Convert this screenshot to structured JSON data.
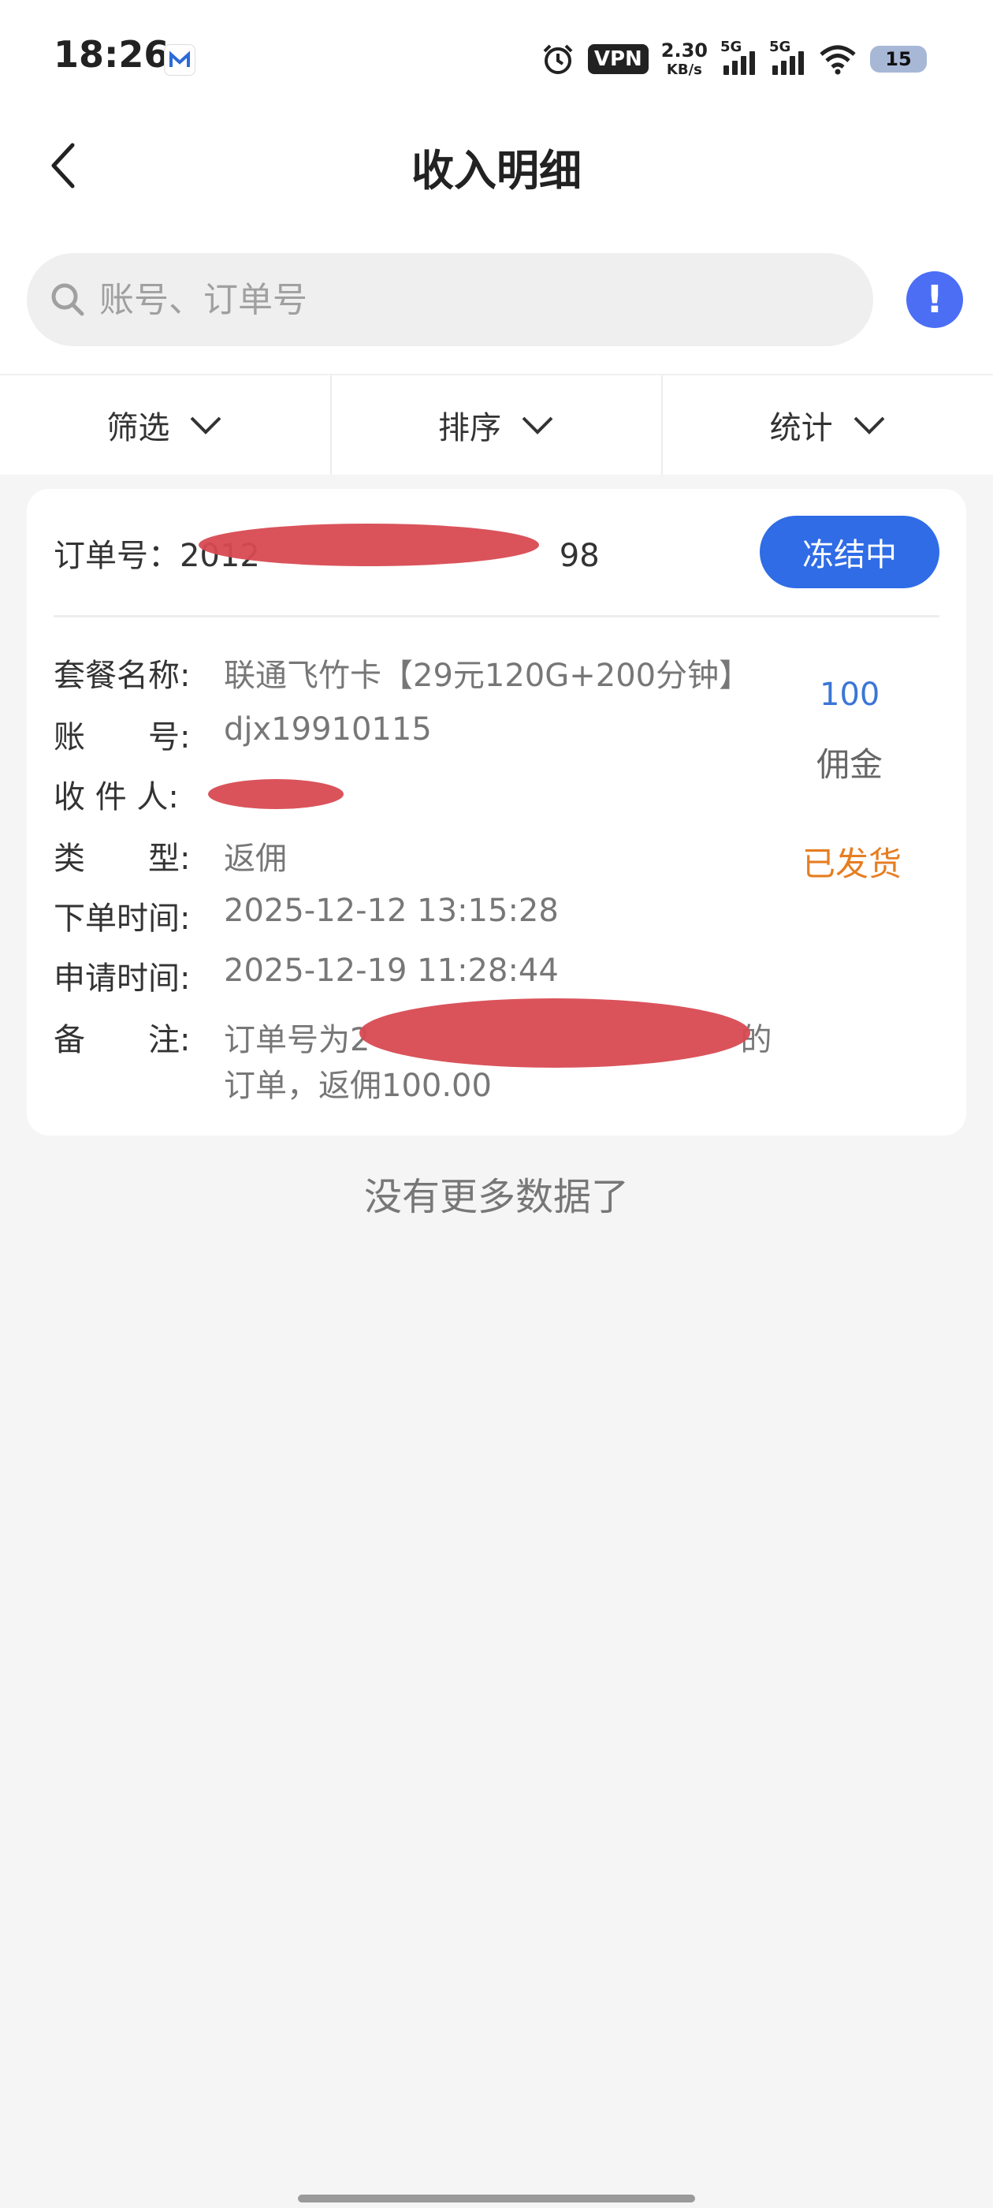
{
  "status_bar": {
    "time": "18:26",
    "vpn": "VPN",
    "speed_value": "2.30",
    "speed_unit": "KB/s",
    "signal1_label": "5G",
    "signal2_label": "5G",
    "battery": "15"
  },
  "header": {
    "title": "收入明细"
  },
  "search": {
    "placeholder": "账号、订单号"
  },
  "info_button": "!",
  "filters": {
    "filter": "筛选",
    "sort": "排序",
    "stats": "统计"
  },
  "card": {
    "order_label": "订单号：",
    "order_prefix": "2012",
    "order_suffix": "98",
    "status": "冻结中",
    "rows": [
      {
        "label": "套餐名称:",
        "value": "联通飞竹卡【29元120G+200分钟】"
      },
      {
        "label": "账　　号:",
        "value": "djx19910115"
      },
      {
        "label": "收 件 人:",
        "value": ""
      },
      {
        "label": "类　　型:",
        "value": "返佣"
      },
      {
        "label": "下单时间:",
        "value": "2025-12-12 13:15:28"
      },
      {
        "label": "申请时间:",
        "value": "2025-12-19 11:28:44"
      },
      {
        "label": "备　　注:",
        "value": "订单号为2",
        "value_end": "的",
        "value_line2": "订单，返佣100.00"
      }
    ],
    "amount": "100",
    "amount_label": "佣金",
    "ship_status": "已发货"
  },
  "footer": {
    "no_more": "没有更多数据了"
  },
  "colors": {
    "accent_blue": "#2f6ce6",
    "info_blue": "#4b6ef5",
    "amount_blue": "#3b76d6",
    "orange": "#e67e22",
    "redaction": "#d84a52"
  }
}
